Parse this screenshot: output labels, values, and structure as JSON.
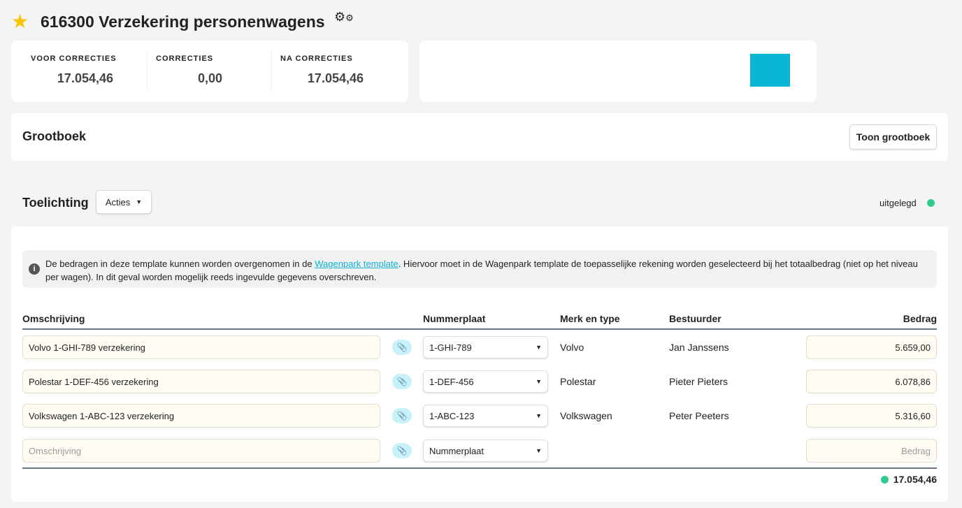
{
  "header": {
    "title": "616300 Verzekering personenwagens"
  },
  "stats": [
    {
      "label": "VOOR CORRECTIES",
      "value": "17.054,46"
    },
    {
      "label": "CORRECTIES",
      "value": "0,00"
    },
    {
      "label": "NA CORRECTIES",
      "value": "17.054,46"
    }
  ],
  "colors": {
    "swatch": "#06b6d4",
    "status": "#2ecc8f"
  },
  "grootboek": {
    "title": "Grootboek",
    "button": "Toon grootboek"
  },
  "toelichting": {
    "title": "Toelichting",
    "acties": "Acties",
    "status": "uitgelegd"
  },
  "info": {
    "before": "De bedragen in deze template kunnen worden overgenomen in de ",
    "link": "Wagenpark template",
    "after": ". Hiervoor moet in de Wagenpark template de toepasselijke rekening worden geselecteerd bij het totaalbedrag (niet op het niveau per wagen). In dit geval worden mogelijk reeds ingevulde gegevens overschreven."
  },
  "table": {
    "headers": {
      "omschrijving": "Omschrijving",
      "nummerplaat": "Nummerplaat",
      "merk": "Merk en type",
      "bestuurder": "Bestuurder",
      "bedrag": "Bedrag"
    },
    "rows": [
      {
        "omschrijving": "Volvo 1-GHI-789 verzekering",
        "nummerplaat": "1-GHI-789",
        "merk": "Volvo",
        "bestuurder": "Jan Janssens",
        "bedrag": "5.659,00"
      },
      {
        "omschrijving": "Polestar 1-DEF-456 verzekering",
        "nummerplaat": "1-DEF-456",
        "merk": "Polestar",
        "bestuurder": "Pieter Pieters",
        "bedrag": "6.078,86"
      },
      {
        "omschrijving": "Volkswagen 1-ABC-123 verzekering",
        "nummerplaat": "1-ABC-123",
        "merk": "Volkswagen",
        "bestuurder": "Peter Peeters",
        "bedrag": "5.316,60"
      }
    ],
    "new_row": {
      "omschrijving_placeholder": "Omschrijving",
      "nummerplaat_placeholder": "Nummerplaat",
      "bedrag_placeholder": "Bedrag"
    },
    "total": "17.054,46"
  }
}
